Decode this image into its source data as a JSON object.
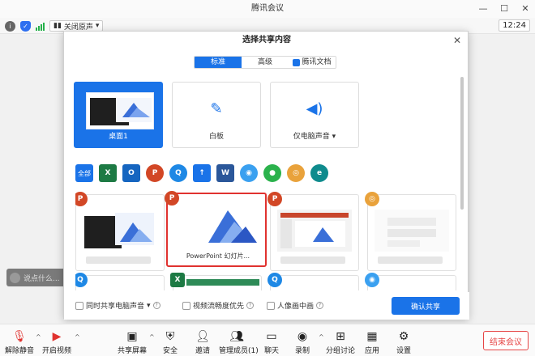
{
  "window": {
    "title": "腾讯会议"
  },
  "status": {
    "audio_label": "关闭原声",
    "clock": "12:24"
  },
  "dialog": {
    "title": "选择共享内容",
    "tabs": [
      {
        "label": "标准",
        "active": true
      },
      {
        "label": "高级",
        "active": false
      },
      {
        "label": "腾讯文档",
        "active": false
      }
    ],
    "share_cards": [
      {
        "label": "桌面1",
        "selected": true
      },
      {
        "label": "白板",
        "selected": false
      },
      {
        "label": "仅电脑声音",
        "selected": false
      }
    ],
    "app_filter": {
      "all_label": "全部",
      "apps": [
        {
          "name": "excel-icon",
          "glyph": "X",
          "color": "#1d7a44"
        },
        {
          "name": "outlook-icon",
          "glyph": "O",
          "color": "#1565c0"
        },
        {
          "name": "powerpoint-icon",
          "glyph": "P",
          "color": "#d24726"
        },
        {
          "name": "browser-q-icon",
          "glyph": "Q",
          "color": "#1e88e5"
        },
        {
          "name": "arrow-app-icon",
          "glyph": "↑",
          "color": "#1a73e8"
        },
        {
          "name": "word-icon",
          "glyph": "W",
          "color": "#2b579a"
        },
        {
          "name": "chat-bubble-icon",
          "glyph": "◉",
          "color": "#3aa0f0"
        },
        {
          "name": "wechat-icon",
          "glyph": "●",
          "color": "#2bb24c"
        },
        {
          "name": "chrome-icon",
          "glyph": "◎",
          "color": "#e9a23b"
        },
        {
          "name": "edge-icon",
          "glyph": "e",
          "color": "#0f8b8d"
        }
      ]
    },
    "windows": [
      {
        "app": "powerpoint",
        "label": ""
      },
      {
        "app": "powerpoint",
        "label": "PowerPoint 幻灯片..."
      },
      {
        "app": "powerpoint",
        "label": ""
      },
      {
        "app": "chrome",
        "label": ""
      }
    ],
    "options": {
      "share_audio": "同时共享电脑声音",
      "smooth_video": "视频流畅度优先",
      "portrait": "人像画中画"
    },
    "confirm_label": "确认共享"
  },
  "speaking_label": "说点什么...",
  "toolbar": {
    "mute": "解除静音",
    "video": "开启视频",
    "share": "共享屏幕",
    "security": "安全",
    "invite": "邀请",
    "members": "管理成员(1)",
    "chat": "聊天",
    "record": "录制",
    "breakout": "分组讨论",
    "apps": "应用",
    "settings": "设置",
    "end": "结束会议"
  }
}
